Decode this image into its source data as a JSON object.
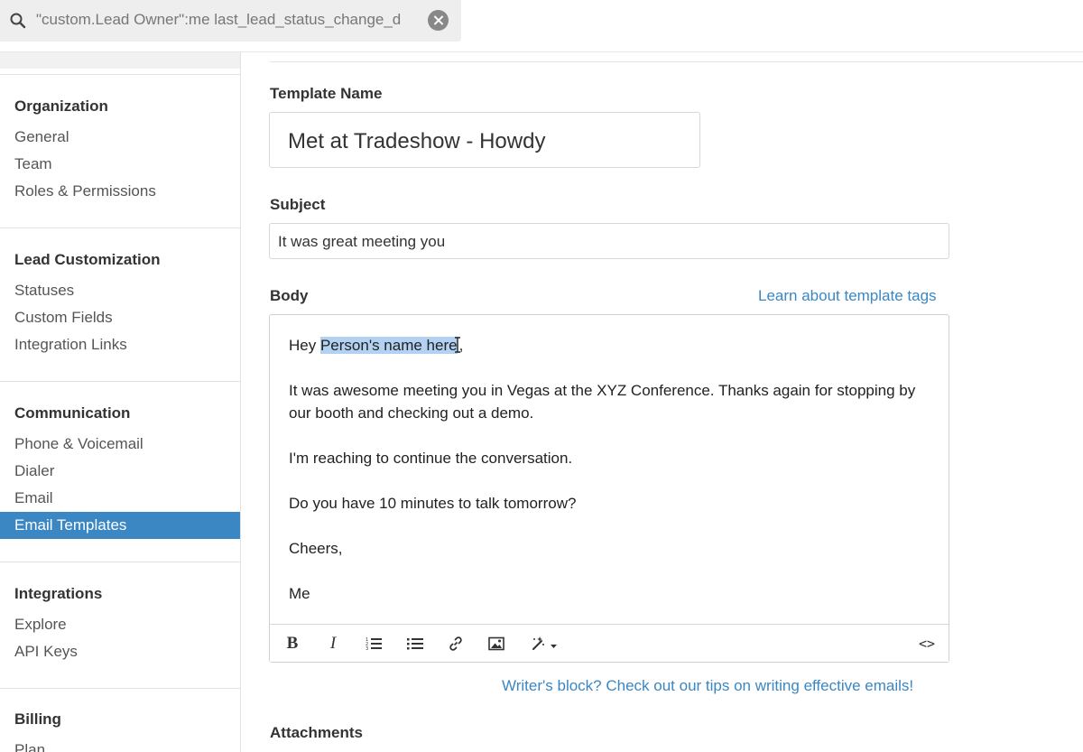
{
  "search": {
    "value": "\"custom.Lead Owner\":me last_lead_status_change_d"
  },
  "sidebar": {
    "sections": [
      {
        "title": "Organization",
        "items": [
          "General",
          "Team",
          "Roles & Permissions"
        ]
      },
      {
        "title": "Lead Customization",
        "items": [
          "Statuses",
          "Custom Fields",
          "Integration Links"
        ]
      },
      {
        "title": "Communication",
        "items": [
          "Phone & Voicemail",
          "Dialer",
          "Email",
          "Email Templates"
        ]
      },
      {
        "title": "Integrations",
        "items": [
          "Explore",
          "API Keys"
        ]
      },
      {
        "title": "Billing",
        "items": [
          "Plan"
        ]
      }
    ],
    "active_item": "Email Templates"
  },
  "form": {
    "template_name_label": "Template Name",
    "template_name_value": "Met at Tradeshow - Howdy",
    "subject_label": "Subject",
    "subject_value": "It was great meeting you",
    "body_label": "Body",
    "template_tags_link": "Learn about template tags",
    "body": {
      "greeting_prefix": "Hey ",
      "greeting_highlight": "Person's name here",
      "greeting_suffix": ",",
      "paragraph_1": "It was awesome meeting you in Vegas at the XYZ Conference. Thanks again for stopping by our booth and checking out a demo.",
      "paragraph_2": "I'm reaching to continue the conversation.",
      "paragraph_3": "Do you have 10 minutes to talk tomorrow?",
      "paragraph_4": "Cheers,",
      "signature": "Me"
    },
    "toolbar": {
      "bold": "B",
      "italic": "I",
      "code_view": "<>"
    },
    "tips_link": "Writer's block? Check out our tips on writing effective emails!",
    "attachments_label": "Attachments"
  },
  "colors": {
    "accent": "#3a87c3",
    "highlight": "#b3d1f2"
  }
}
